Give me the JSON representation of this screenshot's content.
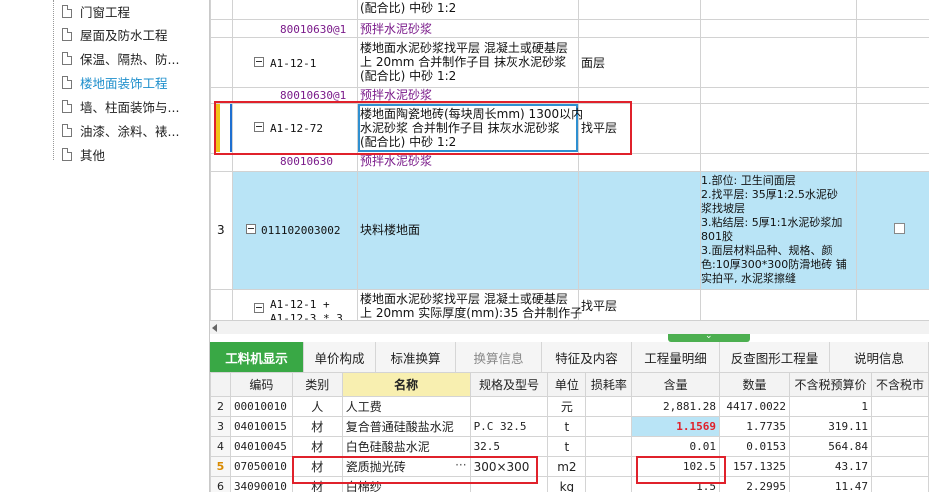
{
  "tree": {
    "items": [
      {
        "label": "门窗工程",
        "active": false
      },
      {
        "label": "屋面及防水工程",
        "active": false
      },
      {
        "label": "保温、隔热、防...",
        "active": false
      },
      {
        "label": "楼地面装饰工程",
        "active": true
      },
      {
        "label": "墙、柱面装饰与...",
        "active": false
      },
      {
        "label": "油漆、涂料、裱...",
        "active": false
      },
      {
        "label": "其他",
        "active": false
      }
    ]
  },
  "grid": {
    "rows": [
      {
        "kind": "sub",
        "code": "80010630@1",
        "name": "预拌水泥砂浆"
      },
      {
        "kind": "quota",
        "code": "A1-12-1",
        "name_lines": [
          "楼地面水泥砂浆找平层 混凝土或硬基层",
          "上 20mm  合并制作子目 抹灰水泥砂浆",
          "(配合比) 中砂 1:2"
        ],
        "feature": "面层"
      },
      {
        "kind": "sub",
        "code": "80010630@1",
        "name": "预拌水泥砂浆"
      },
      {
        "kind": "quota",
        "code": "A1-12-72",
        "name_lines": [
          "楼地面陶瓷地砖(每块周长mm) 1300以内",
          "水泥砂浆  合并制作子目 抹灰水泥砂浆",
          "(配合比) 中砂 1:2"
        ],
        "feature": "找平层"
      },
      {
        "kind": "sub",
        "code": "80010630",
        "name": "预拌水泥砂浆"
      },
      {
        "kind": "item",
        "index": "3",
        "code": "011102003002",
        "name": "块料楼地面",
        "desc_lines": [
          "1.部位: 卫生间面层",
          "2.找平层: 35厚1:2.5水泥砂",
          "浆找坡层",
          "3.粘结层: 5厚1:1水泥砂浆加",
          "801胶",
          "3.面层材料品种、规格、颜",
          "色:10厚300*300防滑地砖 铺",
          "实拍平, 水泥浆擦缝"
        ]
      },
      {
        "kind": "quota",
        "code": "A1-12-1 +",
        "code2": "A1-12-3 * 3",
        "name_lines": [
          "楼地面水泥砂浆找平层 混凝土或硬基层",
          "上 20mm  实际厚度(mm):35  合并制作子"
        ],
        "feature": "找平层"
      }
    ],
    "top_clip": {
      "name": "(配合比) 中砂 1:2"
    }
  },
  "tabs": [
    {
      "label": "工料机显示",
      "state": "active"
    },
    {
      "label": "单价构成",
      "state": "normal"
    },
    {
      "label": "标准换算",
      "state": "normal"
    },
    {
      "label": "换算信息",
      "state": "disabled"
    },
    {
      "label": "特征及内容",
      "state": "normal"
    },
    {
      "label": "工程量明细",
      "state": "normal"
    },
    {
      "label": "反查图形工程量",
      "state": "normal"
    },
    {
      "label": "说明信息",
      "state": "normal"
    }
  ],
  "bottom": {
    "headers": [
      "编码",
      "类别",
      "名称",
      "规格及型号",
      "单位",
      "损耗率",
      "含量",
      "数量",
      "不含税预算价",
      "不含税市"
    ],
    "rows": [
      {
        "idx": "2",
        "code": "00010010",
        "cat": "人",
        "name": "人工费",
        "spec": "",
        "unit": "元",
        "loss": "",
        "content": "2,881.28",
        "qty": "4417.0022",
        "price": "1"
      },
      {
        "idx": "3",
        "code": "04010015",
        "cat": "材",
        "name": "复合普通硅酸盐水泥",
        "spec": "P.C 32.5",
        "unit": "t",
        "loss": "",
        "content": "1.1569",
        "qty": "1.7735",
        "price": "319.11"
      },
      {
        "idx": "4",
        "code": "04010045",
        "cat": "材",
        "name": "白色硅酸盐水泥",
        "spec": "32.5",
        "unit": "t",
        "loss": "",
        "content": "0.01",
        "qty": "0.0153",
        "price": "564.84"
      },
      {
        "idx": "5",
        "code": "07050010",
        "cat": "材",
        "name": "瓷质抛光砖",
        "spec": "300×300",
        "unit": "m2",
        "loss": "",
        "content": "102.5",
        "qty": "157.1325",
        "price": "43.17"
      },
      {
        "idx": "6",
        "code": "34090010",
        "cat": "材",
        "name": "白棉纱",
        "spec": "",
        "unit": "kg",
        "loss": "",
        "content": "1.5",
        "qty": "2.2995",
        "price": "11.47"
      }
    ]
  },
  "colors": {
    "accent_green": "#39a845",
    "row_blue": "#b9e4f6",
    "highlight_red": "#e0212b",
    "sub_purple": "#7a1a8a",
    "active_tree": "#1e8fcc"
  }
}
